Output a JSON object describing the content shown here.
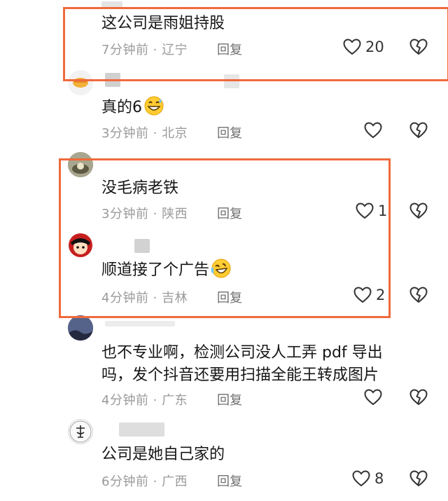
{
  "comments": [
    {
      "text": "这公司是雨姐持股",
      "time": "7分钟前",
      "location": "辽宁",
      "reply": "回复",
      "likes": "20"
    },
    {
      "text": "真的6",
      "time": "3分钟前",
      "location": "北京",
      "reply": "回复",
      "likes": ""
    },
    {
      "text": "没毛病老铁",
      "time": "3分钟前",
      "location": "陕西",
      "reply": "回复",
      "likes": "1"
    },
    {
      "text": "顺道接了个广告",
      "time": "4分钟前",
      "location": "吉林",
      "reply": "回复",
      "likes": "2"
    },
    {
      "text_line1": "也不专业啊，检测公司没人工弄 pdf 导出",
      "text_line2": "吗，发个抖音还要用扫描全能王转成图片",
      "time": "4分钟前",
      "location": "广东",
      "reply": "回复",
      "likes": ""
    },
    {
      "text": "公司是她自己家的",
      "time": "6分钟前",
      "location": "广西",
      "reply": "回复",
      "likes": "8"
    }
  ],
  "separator": " · ",
  "colors": {
    "highlight_box": "#ef6a3c",
    "meta_text": "#9a9a9a"
  }
}
